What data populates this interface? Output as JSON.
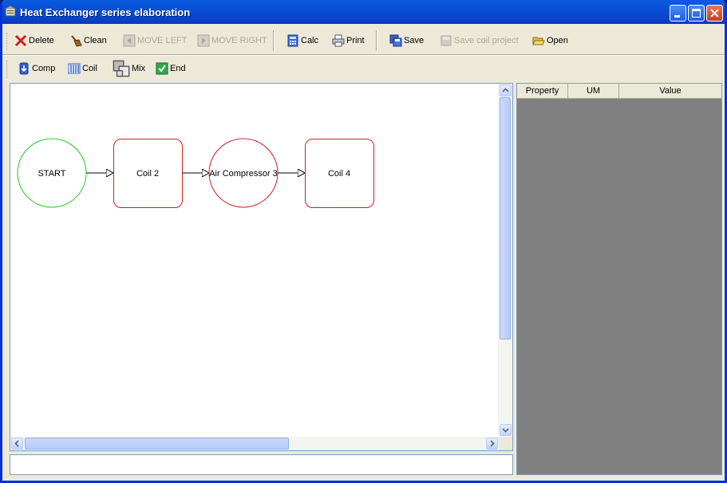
{
  "window": {
    "title": "Heat Exchanger series elaboration"
  },
  "toolbar1": {
    "delete": "Delete",
    "clean": "Clean",
    "move_left": "MOVE LEFT",
    "move_right": "MOVE RIGHT",
    "calc": "Calc",
    "print": "Print",
    "save": "Save",
    "save_coil": "Save coil project",
    "open": "Open"
  },
  "toolbar2": {
    "comp": "Comp",
    "coil": "Coil",
    "mix": "Mix",
    "end": "End"
  },
  "diagram": {
    "nodes": [
      {
        "label": "START",
        "shape": "circle",
        "color": "#22cc22"
      },
      {
        "label": "Coil 2",
        "shape": "rounded-rect",
        "color": "#cc2222"
      },
      {
        "label": "Air Compressor 3",
        "shape": "circle",
        "color": "#cc2222"
      },
      {
        "label": "Coil 4",
        "shape": "rounded-rect",
        "color": "#cc2222"
      }
    ]
  },
  "properties": {
    "columns": [
      "Property",
      "UM",
      "Value"
    ]
  },
  "colors": {
    "title_bar": "#0a4fd5",
    "panel_bg": "#808080",
    "chrome": "#ece9d8"
  }
}
